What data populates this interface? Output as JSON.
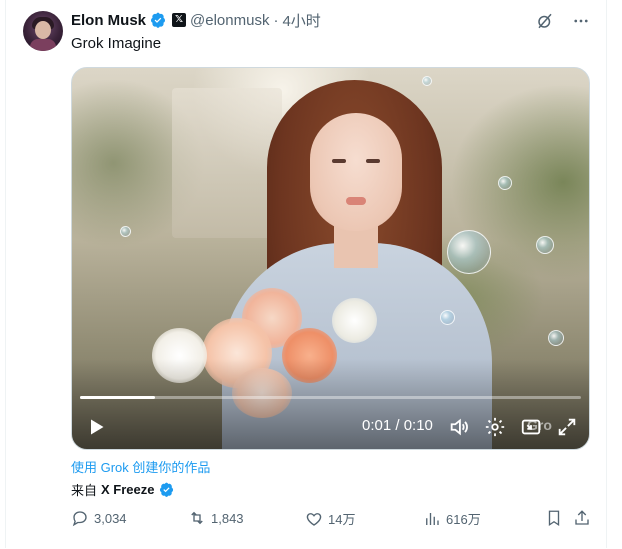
{
  "tweet": {
    "author_name": "Elon Musk",
    "handle": "@elonmusk",
    "separator": "·",
    "time": "4小时",
    "text": "Grok Imagine",
    "verified_color": "#1d9bf0",
    "icons": [
      "grok-icon",
      "more-icon"
    ]
  },
  "video": {
    "timecode": "0:01 / 0:10",
    "progress": 0.15,
    "watermark": "Gro",
    "controls": [
      "play-icon",
      "volume-icon",
      "settings-icon",
      "pip-icon",
      "fullscreen-icon"
    ]
  },
  "links": {
    "grok_cta": "使用 Grok 创建你的作品",
    "source_prefix": "来自",
    "source_name": "X Freeze"
  },
  "actions": {
    "replies": "3,034",
    "reposts": "1,843",
    "likes": "14万",
    "views": "616万"
  }
}
